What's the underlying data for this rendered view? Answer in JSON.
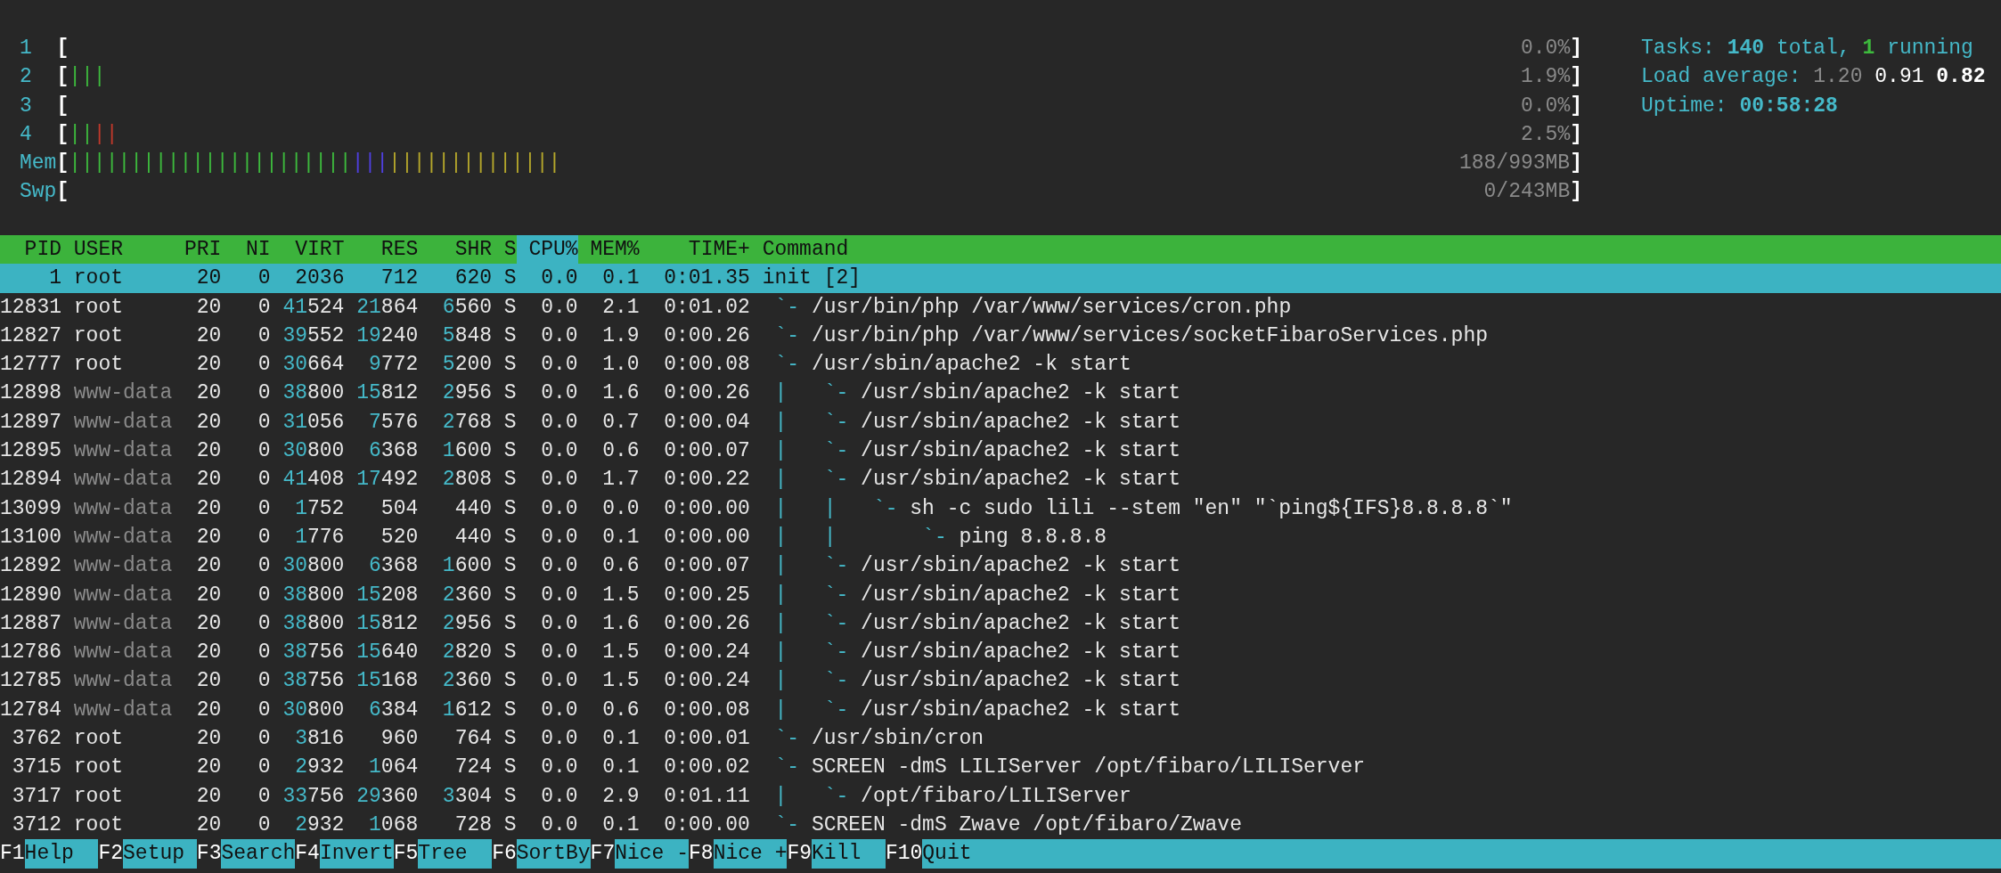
{
  "meters": [
    {
      "label": "1",
      "left_bracket": "[",
      "value": "0.0%",
      "right_bracket": "]"
    },
    {
      "label": "2",
      "left_bracket": "[",
      "segments": [
        {
          "color": "#3dba3d",
          "text": "|||"
        }
      ],
      "value": "1.9%",
      "right_bracket": "]"
    },
    {
      "label": "3",
      "left_bracket": "[",
      "value": "0.0%",
      "right_bracket": "]"
    },
    {
      "label": "4",
      "left_bracket": "[",
      "segments": [
        {
          "color": "#3dba3d",
          "text": "||"
        },
        {
          "color": "#c0392b",
          "text": "||"
        }
      ],
      "value": "2.5%",
      "right_bracket": "]"
    },
    {
      "label": "Mem",
      "left_bracket": "[",
      "segments": [
        {
          "color": "#3dba3d",
          "text": "|||||||||||||||||||||||"
        },
        {
          "color": "#4f3fe0",
          "text": "|||"
        },
        {
          "color": "#b5a72b",
          "text": "||||||||||||||"
        }
      ],
      "value": "188/993MB",
      "right_bracket": "]"
    },
    {
      "label": "Swp",
      "left_bracket": "[",
      "value": "0/243MB",
      "right_bracket": "]"
    }
  ],
  "tasks": {
    "label": "Tasks:",
    "total": "140",
    "total_label": "total,",
    "running": "1",
    "running_label": "running"
  },
  "load_average": {
    "label": "Load average:",
    "values": [
      {
        "text": "1.20",
        "kind": "short"
      },
      {
        "text": "0.91",
        "kind": "mid"
      },
      {
        "text": "0.82",
        "kind": "long"
      }
    ]
  },
  "uptime": {
    "label": "Uptime:",
    "value": "00:58:28"
  },
  "columns": [
    {
      "label": "PID",
      "sorted": false
    },
    {
      "label": "USER",
      "sorted": false
    },
    {
      "label": "PRI",
      "sorted": false
    },
    {
      "label": "NI",
      "sorted": false
    },
    {
      "label": "VIRT",
      "sorted": false
    },
    {
      "label": "RES",
      "sorted": false
    },
    {
      "label": "SHR",
      "sorted": false
    },
    {
      "label": "S",
      "sorted": false
    },
    {
      "label": "CPU%",
      "sorted": true
    },
    {
      "label": "MEM%",
      "sorted": false
    },
    {
      "label": "TIME+",
      "sorted": false
    },
    {
      "label": "Command",
      "sorted": false
    }
  ],
  "processes": [
    {
      "pid": "1",
      "user": "root",
      "user_dimmed": false,
      "pri": "20",
      "ni": "0",
      "virt": "2036",
      "res": "712",
      "shr": "620",
      "state": "S",
      "cpu": "0.0",
      "mem": "0.1",
      "time": "0:01.35",
      "command": "init [2]",
      "selected": true,
      "children": [
        {
          "pid": "12831",
          "user": "root",
          "user_dimmed": false,
          "pri": "20",
          "ni": "0",
          "virt": "41524",
          "res": "21864",
          "shr": "6560",
          "state": "S",
          "cpu": "0.0",
          "mem": "2.1",
          "time": "0:01.02",
          "tree": "`- ",
          "command": "/usr/bin/php /var/www/services/cron.php",
          "selected": false
        },
        {
          "pid": "12827",
          "user": "root",
          "user_dimmed": false,
          "pri": "20",
          "ni": "0",
          "virt": "39552",
          "res": "19240",
          "shr": "5848",
          "state": "S",
          "cpu": "0.0",
          "mem": "1.9",
          "time": "0:00.26",
          "tree": "`- ",
          "command": "/usr/bin/php /var/www/services/socketFibaroServices.php",
          "selected": false
        },
        {
          "pid": "12777",
          "user": "root",
          "user_dimmed": false,
          "pri": "20",
          "ni": "0",
          "virt": "30664",
          "res": "9772",
          "shr": "5200",
          "state": "S",
          "cpu": "0.0",
          "mem": "1.0",
          "time": "0:00.08",
          "tree": "`- ",
          "command": "/usr/sbin/apache2 -k start",
          "selected": false,
          "children": [
            {
              "pid": "12898",
              "user": "www-data",
              "user_dimmed": true,
              "pri": "20",
              "ni": "0",
              "virt": "38800",
              "res": "15812",
              "shr": "2956",
              "state": "S",
              "cpu": "0.0",
              "mem": "1.6",
              "time": "0:00.26",
              "tree": "|   `- ",
              "command": "/usr/sbin/apache2 -k start",
              "selected": false
            },
            {
              "pid": "12897",
              "user": "www-data",
              "user_dimmed": true,
              "pri": "20",
              "ni": "0",
              "virt": "31056",
              "res": "7576",
              "shr": "2768",
              "state": "S",
              "cpu": "0.0",
              "mem": "0.7",
              "time": "0:00.04",
              "tree": "|   `- ",
              "command": "/usr/sbin/apache2 -k start",
              "selected": false
            },
            {
              "pid": "12895",
              "user": "www-data",
              "user_dimmed": true,
              "pri": "20",
              "ni": "0",
              "virt": "30800",
              "res": "6368",
              "shr": "1600",
              "state": "S",
              "cpu": "0.0",
              "mem": "0.6",
              "time": "0:00.07",
              "tree": "|   `- ",
              "command": "/usr/sbin/apache2 -k start",
              "selected": false
            },
            {
              "pid": "12894",
              "user": "www-data",
              "user_dimmed": true,
              "pri": "20",
              "ni": "0",
              "virt": "41408",
              "res": "17492",
              "shr": "2808",
              "state": "S",
              "cpu": "0.0",
              "mem": "1.7",
              "time": "0:00.22",
              "tree": "|   `- ",
              "command": "/usr/sbin/apache2 -k start",
              "selected": false,
              "children": [
                {
                  "pid": "13099",
                  "user": "www-data",
                  "user_dimmed": true,
                  "pri": "20",
                  "ni": "0",
                  "virt": "1752",
                  "res": "504",
                  "shr": "440",
                  "state": "S",
                  "cpu": "0.0",
                  "mem": "0.0",
                  "time": "0:00.00",
                  "tree": "|   |   `- ",
                  "command": "sh -c sudo lili --stem \"en\" \"`ping${IFS}8.8.8.8`\"",
                  "selected": false,
                  "children": [
                    {
                      "pid": "13100",
                      "user": "www-data",
                      "user_dimmed": true,
                      "pri": "20",
                      "ni": "0",
                      "virt": "1776",
                      "res": "520",
                      "shr": "440",
                      "state": "S",
                      "cpu": "0.0",
                      "mem": "0.1",
                      "time": "0:00.00",
                      "tree": "|   |       `- ",
                      "command": "ping 8.8.8.8",
                      "selected": false
                    }
                  ]
                }
              ]
            },
            {
              "pid": "12892",
              "user": "www-data",
              "user_dimmed": true,
              "pri": "20",
              "ni": "0",
              "virt": "30800",
              "res": "6368",
              "shr": "1600",
              "state": "S",
              "cpu": "0.0",
              "mem": "0.6",
              "time": "0:00.07",
              "tree": "|   `- ",
              "command": "/usr/sbin/apache2 -k start",
              "selected": false
            },
            {
              "pid": "12890",
              "user": "www-data",
              "user_dimmed": true,
              "pri": "20",
              "ni": "0",
              "virt": "38800",
              "res": "15208",
              "shr": "2360",
              "state": "S",
              "cpu": "0.0",
              "mem": "1.5",
              "time": "0:00.25",
              "tree": "|   `- ",
              "command": "/usr/sbin/apache2 -k start",
              "selected": false
            },
            {
              "pid": "12887",
              "user": "www-data",
              "user_dimmed": true,
              "pri": "20",
              "ni": "0",
              "virt": "38800",
              "res": "15812",
              "shr": "2956",
              "state": "S",
              "cpu": "0.0",
              "mem": "1.6",
              "time": "0:00.26",
              "tree": "|   `- ",
              "command": "/usr/sbin/apache2 -k start",
              "selected": false
            },
            {
              "pid": "12786",
              "user": "www-data",
              "user_dimmed": true,
              "pri": "20",
              "ni": "0",
              "virt": "38756",
              "res": "15640",
              "shr": "2820",
              "state": "S",
              "cpu": "0.0",
              "mem": "1.5",
              "time": "0:00.24",
              "tree": "|   `- ",
              "command": "/usr/sbin/apache2 -k start",
              "selected": false
            },
            {
              "pid": "12785",
              "user": "www-data",
              "user_dimmed": true,
              "pri": "20",
              "ni": "0",
              "virt": "38756",
              "res": "15168",
              "shr": "2360",
              "state": "S",
              "cpu": "0.0",
              "mem": "1.5",
              "time": "0:00.24",
              "tree": "|   `- ",
              "command": "/usr/sbin/apache2 -k start",
              "selected": false
            },
            {
              "pid": "12784",
              "user": "www-data",
              "user_dimmed": true,
              "pri": "20",
              "ni": "0",
              "virt": "30800",
              "res": "6384",
              "shr": "1612",
              "state": "S",
              "cpu": "0.0",
              "mem": "0.6",
              "time": "0:00.08",
              "tree": "|   `- ",
              "command": "/usr/sbin/apache2 -k start",
              "selected": false
            }
          ]
        },
        {
          "pid": "3762",
          "user": "root",
          "user_dimmed": false,
          "pri": "20",
          "ni": "0",
          "virt": "3816",
          "res": "960",
          "shr": "764",
          "state": "S",
          "cpu": "0.0",
          "mem": "0.1",
          "time": "0:00.01",
          "tree": "`- ",
          "command": "/usr/sbin/cron",
          "selected": false
        },
        {
          "pid": "3715",
          "user": "root",
          "user_dimmed": false,
          "pri": "20",
          "ni": "0",
          "virt": "2932",
          "res": "1064",
          "shr": "724",
          "state": "S",
          "cpu": "0.0",
          "mem": "0.1",
          "time": "0:00.02",
          "tree": "`- ",
          "command": "SCREEN -dmS LILIServer /opt/fibaro/LILIServer",
          "selected": false,
          "children": [
            {
              "pid": "3717",
              "user": "root",
              "user_dimmed": false,
              "pri": "20",
              "ni": "0",
              "virt": "33756",
              "res": "29360",
              "shr": "3304",
              "state": "S",
              "cpu": "0.0",
              "mem": "2.9",
              "time": "0:01.11",
              "tree": "|   `- ",
              "command": "/opt/fibaro/LILIServer",
              "selected": false
            }
          ]
        },
        {
          "pid": "3712",
          "user": "root",
          "user_dimmed": false,
          "pri": "20",
          "ni": "0",
          "virt": "2932",
          "res": "1068",
          "shr": "728",
          "state": "S",
          "cpu": "0.0",
          "mem": "0.1",
          "time": "0:00.00",
          "tree": "`- ",
          "command": "SCREEN -dmS Zwave /opt/fibaro/Zwave",
          "selected": false
        }
      ]
    }
  ],
  "function_keys": [
    {
      "key": "F1",
      "label": "Help"
    },
    {
      "key": "F2",
      "label": "Setup"
    },
    {
      "key": "F3",
      "label": "Search"
    },
    {
      "key": "F4",
      "label": "Invert"
    },
    {
      "key": "F5",
      "label": "Tree"
    },
    {
      "key": "F6",
      "label": "SortBy"
    },
    {
      "key": "F7",
      "label": "Nice -"
    },
    {
      "key": "F8",
      "label": "Nice +"
    },
    {
      "key": "F9",
      "label": "Kill"
    },
    {
      "key": "F10",
      "label": "Quit"
    }
  ]
}
